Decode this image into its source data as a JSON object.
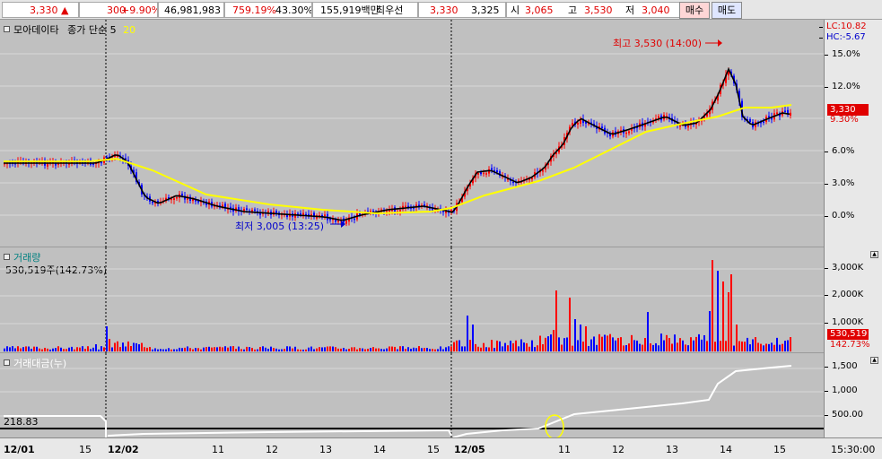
{
  "topbar": {
    "price": "3,330",
    "up_arrow": "▲",
    "change": "300",
    "change_pct": "+9.90%",
    "volume": "46,981,983",
    "volume_ratio": "759.19%",
    "turnover_pct": "43.30%",
    "amount": "155,919백만",
    "best_offer_label": "최우선",
    "best_ask": "3,330",
    "best_bid": "3,325",
    "open_label": "시",
    "open": "3,065",
    "high_label": "고",
    "high": "3,530",
    "low_label": "저",
    "low": "3,040",
    "buy_button": "매수",
    "sell_button": "매도"
  },
  "price_panel": {
    "name": "모아데이타",
    "ma_label": "종가 단순 5",
    "ma_label_2": "20",
    "high_annotation": "최고 3,530 (14:00)",
    "low_annotation": "최저 3,005 (13:25)",
    "lc": "LC:10.82",
    "hc": "HC:-5.67",
    "y_labels": [
      "15.0%",
      "12.0%",
      "9.0%",
      "6.0%",
      "3.0%",
      "0.0%"
    ],
    "current_price_tag": "3,330",
    "current_pct_tag": "9.30%",
    "colors": {
      "up": "#ff0000",
      "down": "#0000ff",
      "ma5": "#000000",
      "ma20": "#ffff00"
    }
  },
  "volume_panel": {
    "title": "거래량",
    "value_label": "530,519주(142.73%)",
    "y_labels": [
      "3,000K",
      "2,000K",
      "1,000K"
    ],
    "current_tag": "530,519",
    "current_pct": "142.73%"
  },
  "amount_panel": {
    "title": "거래대금(누)",
    "left_value": "218.83",
    "y_labels": [
      "1,500",
      "1,000",
      "500.00"
    ]
  },
  "x_axis": {
    "labels": [
      "12/01",
      "15",
      "12/02",
      "11",
      "12",
      "13",
      "14",
      "15",
      "12/05",
      "11",
      "12",
      "13",
      "14",
      "15"
    ],
    "time": "15:30:00"
  }
}
